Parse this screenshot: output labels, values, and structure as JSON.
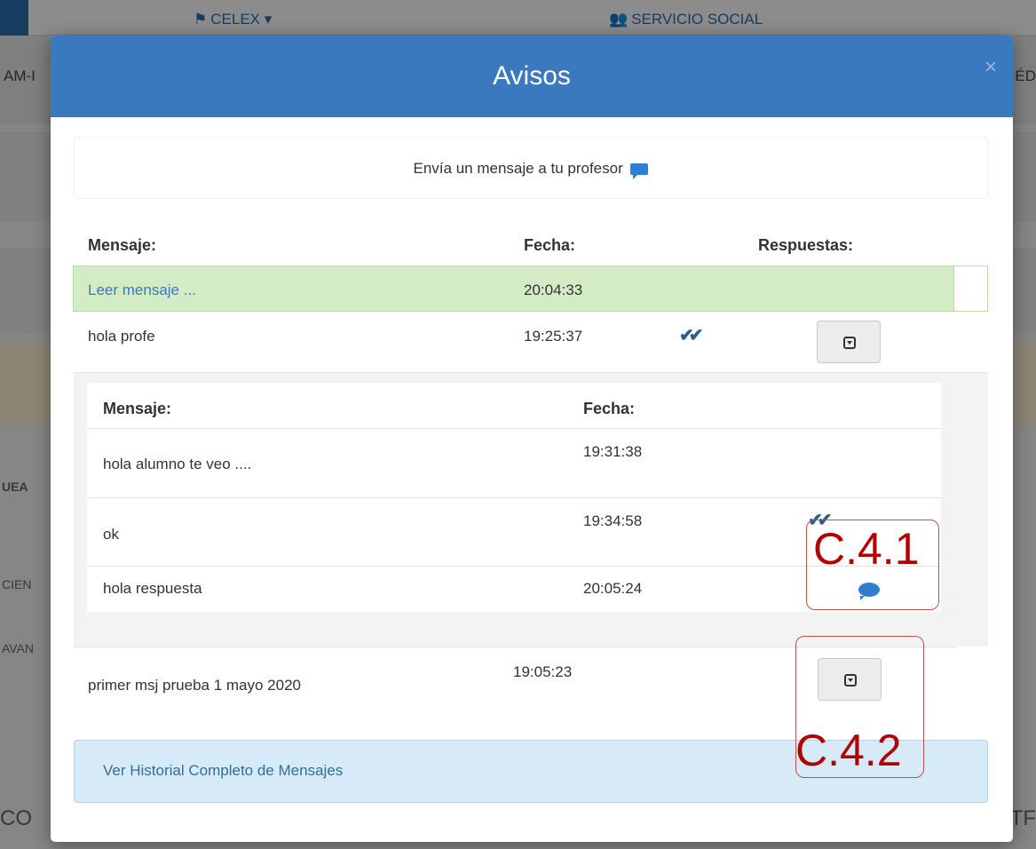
{
  "background": {
    "nav": {
      "celex": "CELEX",
      "servicio_social": "SERVICIO SOCIAL"
    },
    "sub_left": "AM-I",
    "sub_right": "ÉD",
    "labels": {
      "uea": "UEA",
      "cien": "CIEN",
      "avan": "AVAN"
    },
    "footer_left": "CO",
    "footer_right": "TF"
  },
  "modal": {
    "title": "Avisos",
    "close": "×",
    "send_message": "Envía un mensaje a tu profesor",
    "table": {
      "headers": {
        "message": "Mensaje:",
        "date": "Fecha:",
        "replies": "Respuestas:"
      },
      "rows": [
        {
          "message": "Leer mensaje ...",
          "date": "20:04:33"
        },
        {
          "message": "hola profe",
          "date": "19:25:37",
          "read": "✔✔"
        },
        {
          "message": "primer msj prueba 1 mayo 2020",
          "date": "19:05:23"
        }
      ]
    },
    "replies": {
      "headers": {
        "message": "Mensaje:",
        "date": "Fecha:"
      },
      "rows": [
        {
          "message": "hola alumno te veo ....",
          "date": "19:31:38"
        },
        {
          "message": "ok",
          "date": "19:34:58",
          "read": "✔✔"
        },
        {
          "message": "hola respuesta",
          "date": "20:05:24"
        }
      ]
    },
    "history_link": "Ver Historial Completo de Mensajes"
  },
  "annotations": {
    "a1": "C.4.1",
    "a2": "C.4.2"
  },
  "colors": {
    "header": "#3a79bd",
    "highlight_row": "#d4ecc5",
    "history_bg": "#d6ebf7",
    "annotation": "#b00000"
  }
}
